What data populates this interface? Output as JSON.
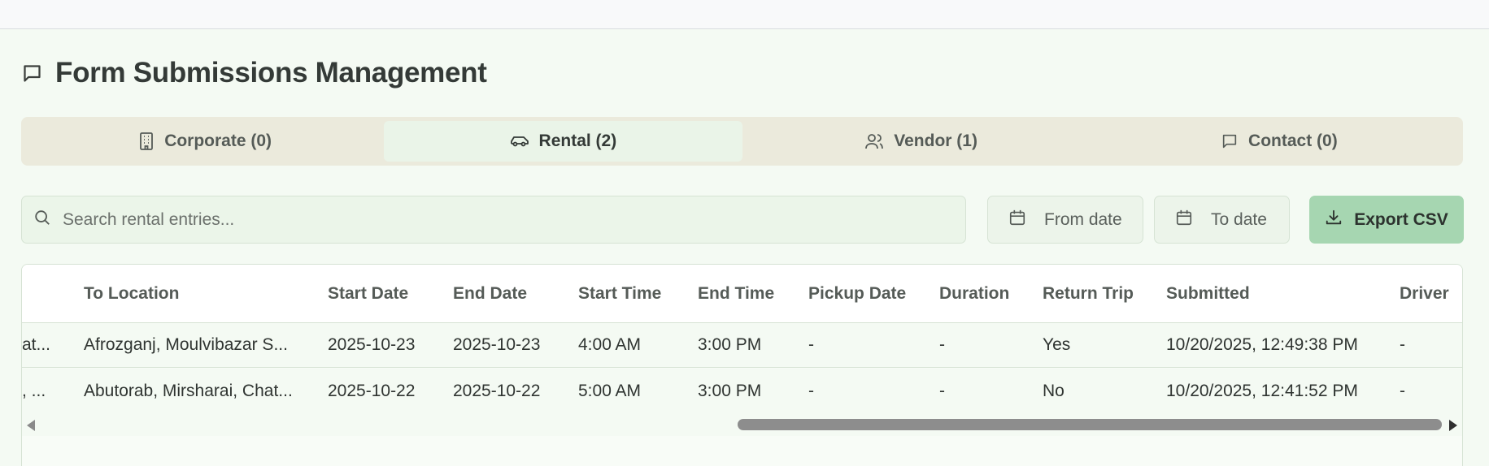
{
  "page": {
    "title": "Form Submissions Management"
  },
  "tabs": [
    {
      "label": "Corporate (0)",
      "icon": "building-icon",
      "active": false
    },
    {
      "label": "Rental (2)",
      "icon": "car-icon",
      "active": true
    },
    {
      "label": "Vendor (1)",
      "icon": "users-icon",
      "active": false
    },
    {
      "label": "Contact (0)",
      "icon": "message-icon",
      "active": false
    }
  ],
  "filters": {
    "search_placeholder": "Search rental entries...",
    "from_date_label": "From date",
    "to_date_label": "To date",
    "export_label": "Export CSV"
  },
  "table": {
    "columns": [
      "To Location",
      "Start Date",
      "End Date",
      "Start Time",
      "End Time",
      "Pickup Date",
      "Duration",
      "Return Trip",
      "Submitted",
      "Driver"
    ],
    "rows": [
      {
        "from_partial": "at...",
        "to_location": "Afrozganj, Moulvibazar S...",
        "start_date": "2025-10-23",
        "end_date": "2025-10-23",
        "start_time": "4:00 AM",
        "end_time": "3:00 PM",
        "pickup_date": "-",
        "duration": "-",
        "return_trip": "Yes",
        "submitted": "10/20/2025, 12:49:38 PM",
        "driver": "-"
      },
      {
        "from_partial": ", ...",
        "to_location": "Abutorab, Mirsharai, Chat...",
        "start_date": "2025-10-22",
        "end_date": "2025-10-22",
        "start_time": "5:00 AM",
        "end_time": "3:00 PM",
        "pickup_date": "-",
        "duration": "-",
        "return_trip": "No",
        "submitted": "10/20/2025, 12:41:52 PM",
        "driver": "-"
      }
    ],
    "horizontal_scroll_fraction": 0.5
  },
  "colors": {
    "background": "#f4faf3",
    "tab_strip": "#ebeadc",
    "active_tab": "#eaf4e8",
    "export_button": "#a6d6b1"
  }
}
